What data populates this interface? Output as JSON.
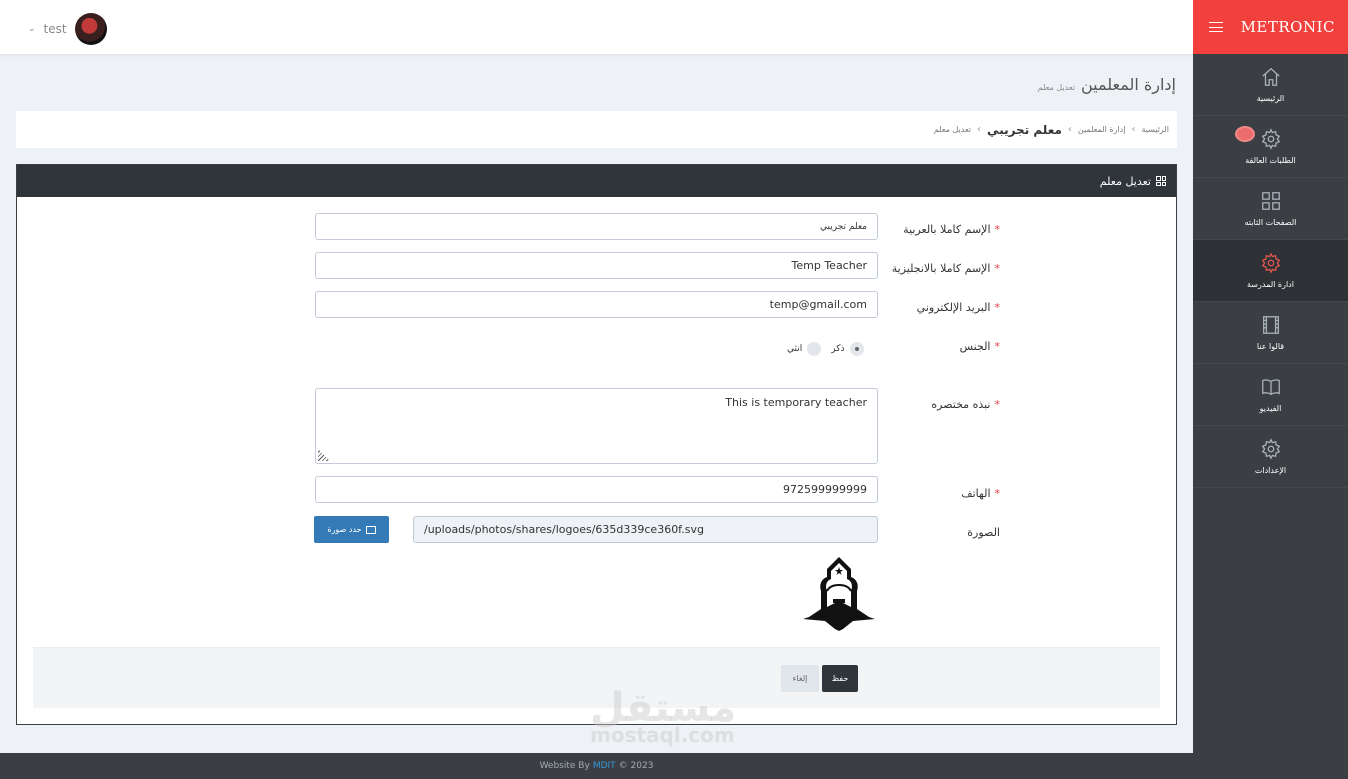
{
  "header": {
    "user_name": "test"
  },
  "sidebar": {
    "brand": "METRONIC",
    "items": [
      {
        "label": "الرئيسية",
        "icon": "home-icon"
      },
      {
        "label": "الطلبات العالقة",
        "icon": "gear-icon"
      },
      {
        "label": "الصفحات الثابته",
        "icon": "grid-icon"
      },
      {
        "label": "ادارة المدرسة",
        "icon": "gear-icon"
      },
      {
        "label": "قالوا عنا",
        "icon": "film-icon"
      },
      {
        "label": "الفيديو",
        "icon": "book-icon"
      },
      {
        "label": "الإعدادات",
        "icon": "gear-icon"
      }
    ]
  },
  "page": {
    "title": "إدارة المعلمين",
    "subtitle": "تعديل معلم"
  },
  "breadcrumb": {
    "home": "الرئيسية",
    "section": "إدارة المعلمين",
    "current": "معلم تجريبي",
    "action": "تعديل معلم"
  },
  "portlet": {
    "title": "تعديل معلم"
  },
  "form": {
    "name_ar": {
      "label": "الإسم كاملا بالعربية",
      "value": "معلم تجريبي"
    },
    "name_en": {
      "label": "الإسم كاملا بالانجليزية",
      "value": "Temp Teacher"
    },
    "email": {
      "label": "البريد الإلكتروني",
      "value": "temp@gmail.com"
    },
    "gender": {
      "label": "الجنس",
      "male": "ذكر",
      "female": "انثي",
      "selected": "male"
    },
    "bio": {
      "label": "نبذه مختصره",
      "value": "This is temporary teacher"
    },
    "phone": {
      "label": "الهاتف",
      "value": "972599999999"
    },
    "photo": {
      "label": "الصورة",
      "button": "حدد صورة",
      "path": "/uploads/photos/shares/logoes/635d339ce360f.svg"
    },
    "save": "حفظ",
    "cancel": "إلغاء"
  },
  "watermark": {
    "text": "مستقل",
    "sub": "mostaql.com"
  },
  "footer": {
    "prefix": "Website By",
    "link": "MDIT",
    "suffix": "© 2023"
  },
  "colors": {
    "accent": "#f2413c",
    "sidebar": "#3b3f44",
    "primary": "#337ab7",
    "dark": "#2f353b"
  }
}
